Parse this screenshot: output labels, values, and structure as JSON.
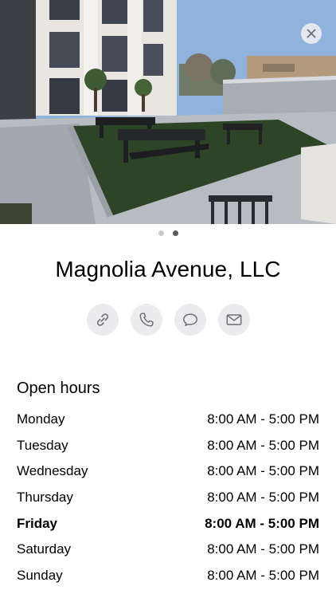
{
  "photo": {
    "icons": {
      "close": "close-icon"
    },
    "pager": {
      "count": 2,
      "active_index": 1
    }
  },
  "business": {
    "name": "Magnolia Avenue, LLC"
  },
  "actions": [
    {
      "name": "link-button",
      "icon": "link-icon"
    },
    {
      "name": "phone-button",
      "icon": "phone-icon"
    },
    {
      "name": "message-button",
      "icon": "message-icon"
    },
    {
      "name": "email-button",
      "icon": "mail-icon"
    }
  ],
  "hours": {
    "title": "Open hours",
    "days": [
      {
        "day": "Monday",
        "time": "8:00 AM - 5:00 PM",
        "today": false
      },
      {
        "day": "Tuesday",
        "time": "8:00 AM - 5:00 PM",
        "today": false
      },
      {
        "day": "Wednesday",
        "time": "8:00 AM - 5:00 PM",
        "today": false
      },
      {
        "day": "Thursday",
        "time": "8:00 AM - 5:00 PM",
        "today": false
      },
      {
        "day": "Friday",
        "time": "8:00 AM - 5:00 PM",
        "today": true
      },
      {
        "day": "Saturday",
        "time": "8:00 AM - 5:00 PM",
        "today": false
      },
      {
        "day": "Sunday",
        "time": "8:00 AM - 5:00 PM",
        "today": false
      }
    ]
  },
  "colors": {
    "button_bg": "#ececee",
    "icon": "#6e6e73",
    "dot_active": "#5a5a5e",
    "dot_inactive": "#c7c7cc"
  }
}
